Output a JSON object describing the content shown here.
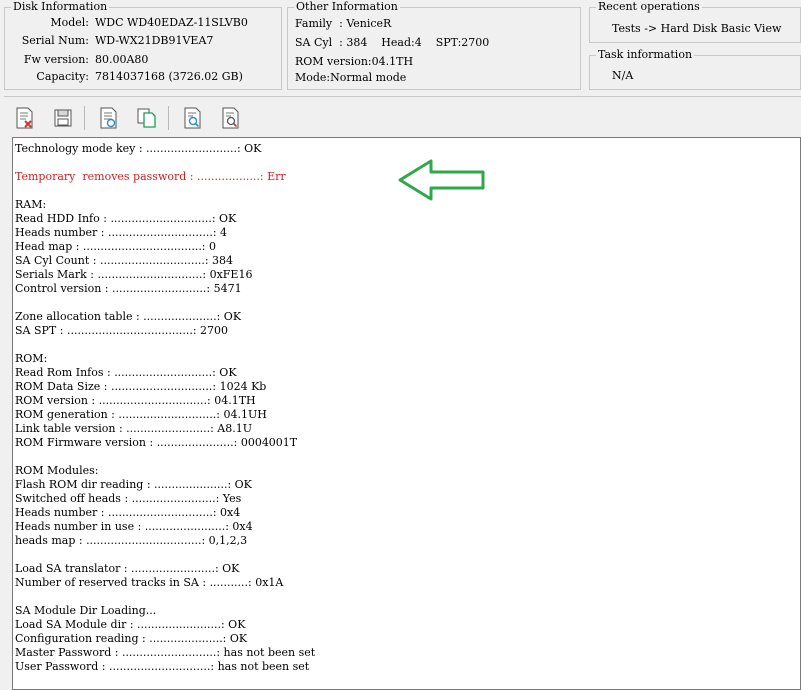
{
  "disk_information": {
    "title": "Disk Information",
    "model_label": "Model:",
    "model": "WDC WD40EDAZ-11SLVB0",
    "serial_label": "Serial Num:",
    "serial": "WD-WX21DB91VEA7",
    "fw_label": "Fw version:",
    "fw": "80.00A80",
    "capacity_label": "Capacity:",
    "capacity": "7814037168 (3726.02 GB)"
  },
  "other_information": {
    "title": "Other Information",
    "line1": "Family  : VeniceR",
    "line2": "SA Cyl  : 384    Head:4    SPT:2700",
    "line3": "ROM version:04.1TH",
    "line4": "Mode:Normal mode"
  },
  "recent_operations": {
    "title": "Recent operations",
    "item": "Tests -> Hard Disk Basic View"
  },
  "task_information": {
    "title": "Task information",
    "value": "N/A"
  },
  "toolbar": {
    "icons": [
      "clear-log-icon",
      "save-icon",
      "report-icon",
      "copy-icon",
      "search-log-icon",
      "export-log-icon"
    ]
  },
  "log_lines": [
    "Technology mode key : ..........................: OK",
    "",
    "Temporary  removes password : ..................: Err",
    "",
    "RAM:",
    "Read HDD Info : .............................: OK",
    "Heads number : ..............................: 4",
    "Head map : ..................................: 0",
    "SA Cyl Count : ..............................: 384",
    "Serials Mark : ..............................: 0xFE16",
    "Control version : ...........................: 5471",
    "",
    "Zone allocation table : .....................: OK",
    "SA SPT : ....................................: 2700",
    "",
    "ROM:",
    "Read Rom Infos : ............................: OK",
    "ROM Data Size : .............................: 1024 Kb",
    "ROM version : ...............................: 04.1TH",
    "ROM generation : ............................: 04.1UH",
    "Link table version : ........................: A8.1U",
    "ROM Firmware version : ......................: 0004001T",
    "",
    "ROM Modules:",
    "Flash ROM dir reading : .....................: OK",
    "Switched off heads : ........................: Yes",
    "Heads number : ..............................: 0x4",
    "Heads number in use : .......................: 0x4",
    "heads map : .................................: 0,1,2,3",
    "",
    "Load SA translator : ........................: OK",
    "Number of reserved tracks in SA : ...........: 0x1A",
    "",
    "SA Module Dir Loading...",
    "Load SA Module dir : ........................: OK",
    "Configuration reading : .....................: OK",
    "Master Password : ...........................: has not been set",
    "User Password : .............................: has not been set"
  ],
  "colors": {
    "error_text": "#d11e1e",
    "arrow": "#2ea84a"
  }
}
